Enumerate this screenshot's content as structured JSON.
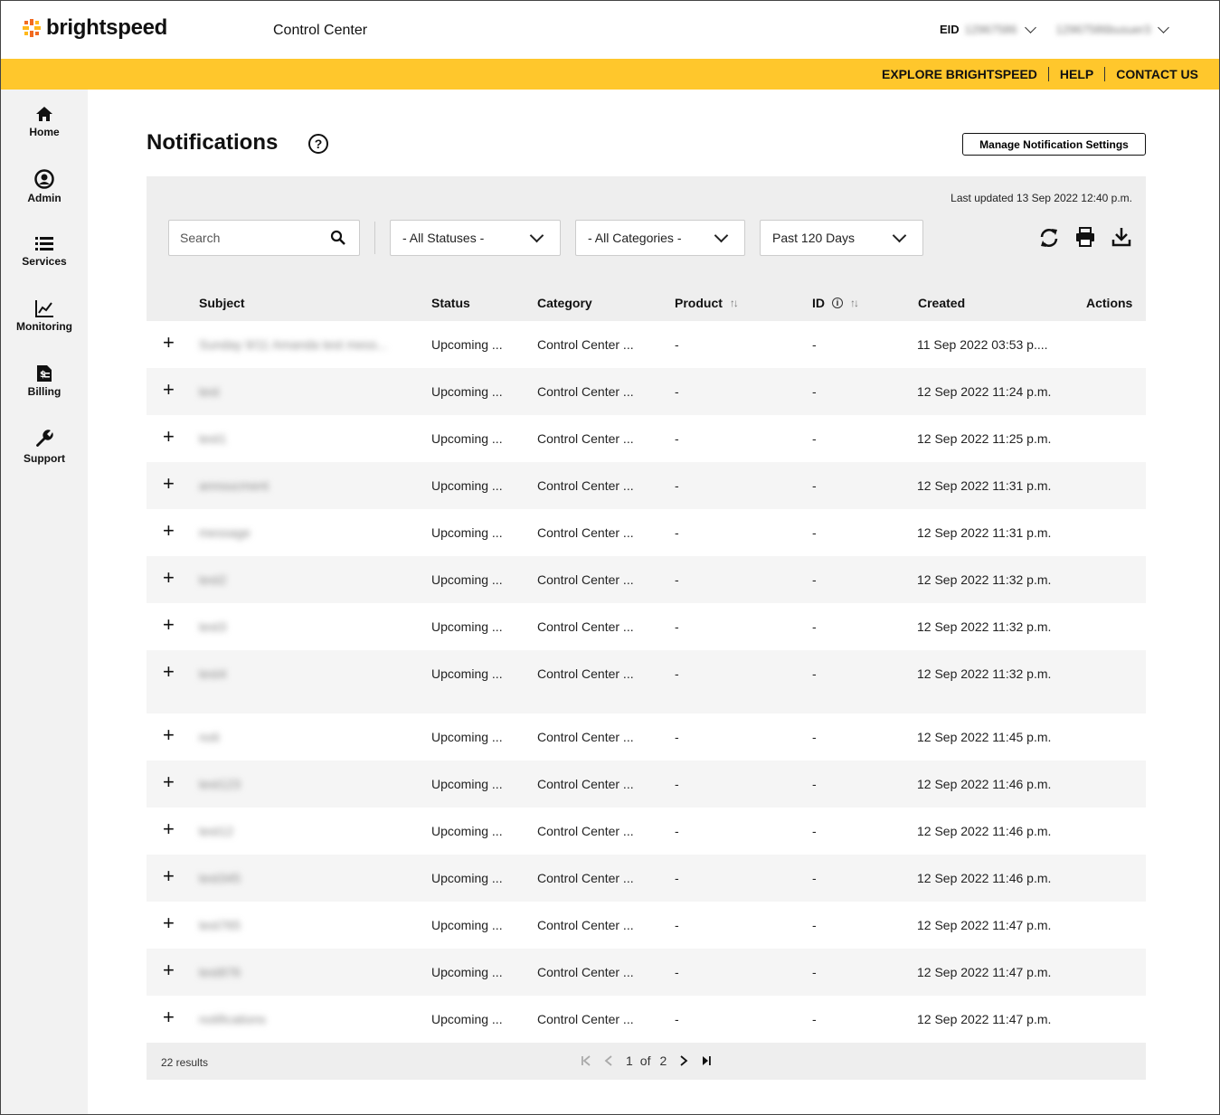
{
  "header": {
    "brand": "brightspeed",
    "app_title": "Control Center",
    "eid_label": "EID",
    "eid_value": "12967586",
    "user_value": "12967586busuer3"
  },
  "top_links": [
    "EXPLORE BRIGHTSPEED",
    "HELP",
    "CONTACT US"
  ],
  "sidebar": {
    "items": [
      {
        "label": "Home",
        "icon": "home-icon"
      },
      {
        "label": "Admin",
        "icon": "user-icon"
      },
      {
        "label": "Services",
        "icon": "list-icon"
      },
      {
        "label": "Monitoring",
        "icon": "chart-icon"
      },
      {
        "label": "Billing",
        "icon": "invoice-icon"
      },
      {
        "label": "Support",
        "icon": "wrench-icon"
      }
    ]
  },
  "page": {
    "title": "Notifications",
    "help_symbol": "?",
    "manage_button": "Manage Notification Settings",
    "last_updated": "Last updated 13 Sep 2022 12:40 p.m."
  },
  "filters": {
    "search_placeholder": "Search",
    "status": "- All Statuses -",
    "category": "- All Categories -",
    "range": "Past 120 Days"
  },
  "table": {
    "columns": [
      "Subject",
      "Status",
      "Category",
      "Product",
      "ID",
      "Created",
      "Actions"
    ],
    "rows": [
      {
        "subject": "Sunday 9/11 Amanda test mess...",
        "status": "Upcoming ...",
        "category": "Control Center ...",
        "product": "-",
        "id": "-",
        "created": "11 Sep 2022 03:53 p...."
      },
      {
        "subject": "test",
        "status": "Upcoming ...",
        "category": "Control Center ...",
        "product": "-",
        "id": "-",
        "created": "12 Sep 2022 11:24 p.m."
      },
      {
        "subject": "test1",
        "status": "Upcoming ...",
        "category": "Control Center ...",
        "product": "-",
        "id": "-",
        "created": "12 Sep 2022 11:25 p.m."
      },
      {
        "subject": "annoucment",
        "status": "Upcoming ...",
        "category": "Control Center ...",
        "product": "-",
        "id": "-",
        "created": "12 Sep 2022 11:31 p.m."
      },
      {
        "subject": "message",
        "status": "Upcoming ...",
        "category": "Control Center ...",
        "product": "-",
        "id": "-",
        "created": "12 Sep 2022 11:31 p.m."
      },
      {
        "subject": "test2",
        "status": "Upcoming ...",
        "category": "Control Center ...",
        "product": "-",
        "id": "-",
        "created": "12 Sep 2022 11:32 p.m."
      },
      {
        "subject": "test3",
        "status": "Upcoming ...",
        "category": "Control Center ...",
        "product": "-",
        "id": "-",
        "created": "12 Sep 2022 11:32 p.m."
      },
      {
        "subject": "test4",
        "status": "Upcoming ...",
        "category": "Control Center ...",
        "product": "-",
        "id": "-",
        "created": "12 Sep 2022 11:32 p.m."
      },
      {
        "subject": "noti",
        "status": "Upcoming ...",
        "category": "Control Center ...",
        "product": "-",
        "id": "-",
        "created": "12 Sep 2022 11:45 p.m."
      },
      {
        "subject": "test123",
        "status": "Upcoming ...",
        "category": "Control Center ...",
        "product": "-",
        "id": "-",
        "created": "12 Sep 2022 11:46 p.m."
      },
      {
        "subject": "test12",
        "status": "Upcoming ...",
        "category": "Control Center ...",
        "product": "-",
        "id": "-",
        "created": "12 Sep 2022 11:46 p.m."
      },
      {
        "subject": "test345",
        "status": "Upcoming ...",
        "category": "Control Center ...",
        "product": "-",
        "id": "-",
        "created": "12 Sep 2022 11:46 p.m."
      },
      {
        "subject": "test765",
        "status": "Upcoming ...",
        "category": "Control Center ...",
        "product": "-",
        "id": "-",
        "created": "12 Sep 2022 11:47 p.m."
      },
      {
        "subject": "test876",
        "status": "Upcoming ...",
        "category": "Control Center ...",
        "product": "-",
        "id": "-",
        "created": "12 Sep 2022 11:47 p.m."
      },
      {
        "subject": "notifications",
        "status": "Upcoming ...",
        "category": "Control Center ...",
        "product": "-",
        "id": "-",
        "created": "12 Sep 2022 11:47 p.m."
      }
    ]
  },
  "footer": {
    "results": "22 results",
    "current_page": "1",
    "of_label": "of",
    "total_pages": "2"
  },
  "colors": {
    "accent": "#ffc72c",
    "brand_orange": "#f26b21"
  }
}
